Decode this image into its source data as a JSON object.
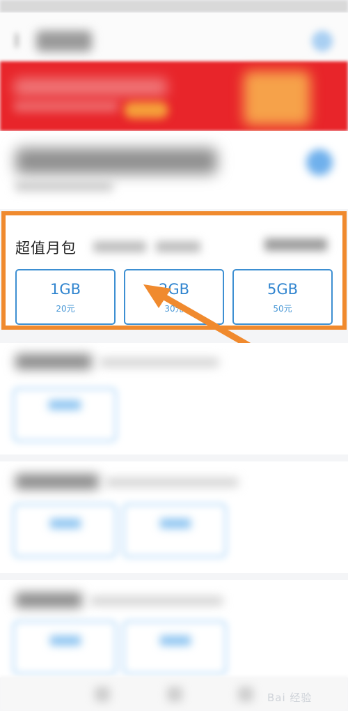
{
  "package": {
    "title": "超值月包",
    "options": [
      {
        "size": "1GB",
        "price": "20元"
      },
      {
        "size": "2GB",
        "price": "30元"
      },
      {
        "size": "5GB",
        "price": "50元"
      }
    ]
  },
  "watermark": "Bai 经验",
  "colors": {
    "banner_red": "#e8252a",
    "accent_blue": "#2f84cf",
    "highlight_orange": "#f08a2e"
  }
}
